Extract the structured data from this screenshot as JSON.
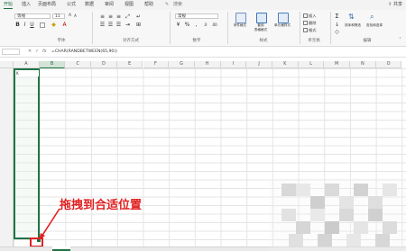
{
  "tabs": [
    "开始",
    "插入",
    "页面布局",
    "公式",
    "数据",
    "审阅",
    "视图",
    "帮助"
  ],
  "share_label": "共享",
  "ribbon": {
    "font_name": "等线",
    "font_size": "11",
    "number_format": "常规",
    "groups": [
      "字体",
      "对齐方式",
      "数字",
      "样式",
      "单元格",
      "编辑"
    ],
    "style_buttons": [
      "条件格式",
      "套用\n表格格式",
      "单元格样式"
    ],
    "cell_buttons": [
      "插入",
      "删除",
      "格式"
    ],
    "edit_buttons": [
      "排序和筛选",
      "查找和选择"
    ]
  },
  "formula_bar": {
    "cell_ref": "",
    "formula": "=CHAR(RANDBETWEEN(65,90))"
  },
  "columns": [
    "A",
    "B",
    "C",
    "D",
    "E",
    "F",
    "G",
    "H",
    "I",
    "J",
    "K",
    "L",
    "M",
    "N",
    "O"
  ],
  "active_cell_value": "K",
  "annotation": "拖拽到合适位置",
  "colors": {
    "accent": "#217346",
    "annotation": "#e02020"
  }
}
